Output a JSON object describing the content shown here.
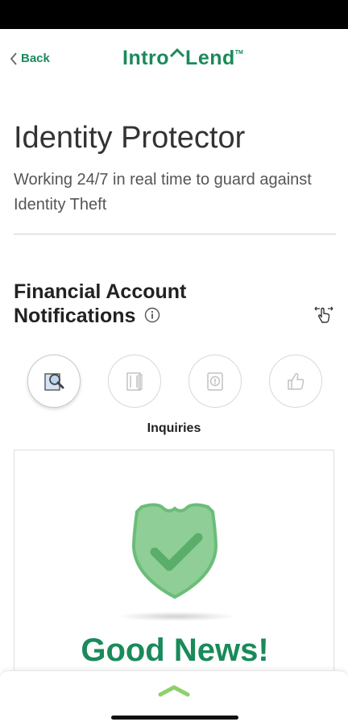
{
  "nav": {
    "back_label": "Back",
    "logo_left": "Intro",
    "logo_right": "Lend",
    "logo_tm": "TM"
  },
  "page": {
    "title": "Identity Protector",
    "subtitle": "Working 24/7 in real time to guard against Identity Theft"
  },
  "section": {
    "title": "Financial Account Notifications"
  },
  "tabs": {
    "items": [
      {
        "icon": "magnifier-icon",
        "active": true
      },
      {
        "icon": "account-icon",
        "active": false
      },
      {
        "icon": "alert-icon",
        "active": false
      },
      {
        "icon": "thumbs-up-icon",
        "active": false
      }
    ],
    "selected_label": "Inquiries"
  },
  "card": {
    "icon": "shield-check-icon",
    "headline": "Good News!"
  },
  "colors": {
    "brand_green": "#1a8a5a",
    "shield_green": "#7dc487"
  }
}
